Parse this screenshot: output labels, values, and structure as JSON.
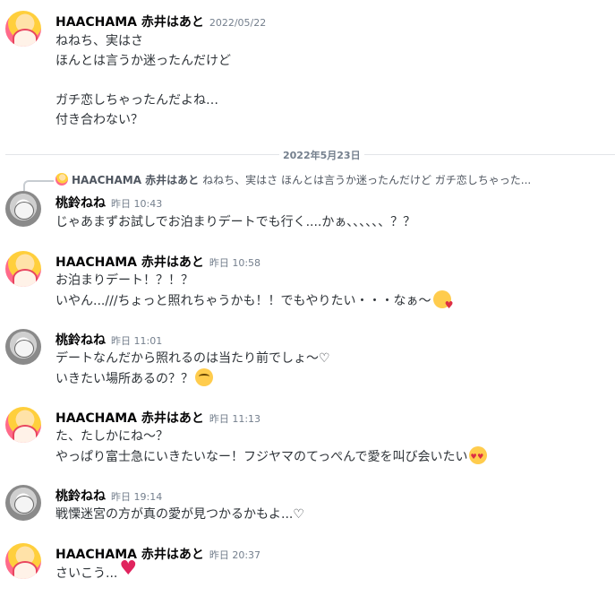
{
  "top_separator": "",
  "messages": [
    {
      "author": "HAACHAMA 赤井はあと",
      "timestamp": "2022/05/22",
      "lines": [
        "ねねち、実はさ",
        "ほんとは言うか迷ったんだけど",
        "",
        "ガチ恋しちゃったんだよね…",
        "付き合わない？"
      ]
    },
    {
      "author": "桃鈴ねね",
      "timestamp": "昨日 10:43",
      "lines": [
        "じゃあまずお試しでお泊まりデートでも行く....かぁ、、、、、、？？"
      ]
    },
    {
      "author": "HAACHAMA 赤井はあと",
      "timestamp": "昨日 10:58",
      "lines": [
        "お泊まりデート！？！？",
        "いやん...///ちょっと照れちゃうかも！！でもやりたい・・・なぁ～"
      ]
    },
    {
      "author": "桃鈴ねね",
      "timestamp": "昨日 11:01",
      "lines": [
        "デートなんだから照れるのは当たり前でしょ～♡",
        "いきたい場所あるの？？"
      ]
    },
    {
      "author": "HAACHAMA 赤井はあと",
      "timestamp": "昨日 11:13",
      "lines": [
        "た、たしかにね～？",
        "やっぱり富士急にいきたいなー！フジヤマのてっぺんで愛を叫び会いたい"
      ]
    },
    {
      "author": "桃鈴ねね",
      "timestamp": "昨日 19:14",
      "lines": [
        "戦慄迷宮の方が真の愛が見つかるかもよ...♡"
      ]
    },
    {
      "author": "HAACHAMA 赤井はあと",
      "timestamp": "昨日 20:37",
      "lines": [
        "さいこう..."
      ]
    }
  ],
  "date_divider": "2022年5月23日",
  "reply": {
    "author": "HAACHAMA 赤井はあと",
    "preview": "ねねち、実はさ ほんとは言うか迷ったんだけど ガチ恋しちゃった..."
  },
  "emojis": {
    "m2_l1": "kissing-heart-icon",
    "m3_l1": "rolling-eyes-icon",
    "m4_l1": "heart-eyes-icon",
    "m6_l0": "sparkling-heart-icon"
  }
}
